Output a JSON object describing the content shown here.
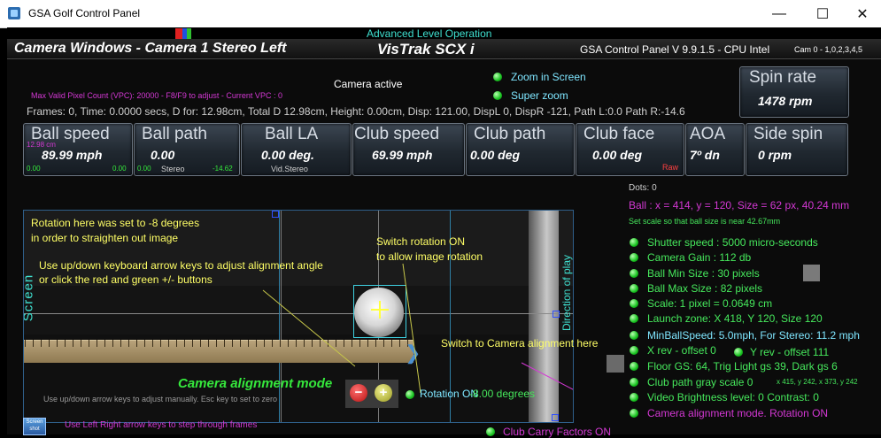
{
  "window": {
    "title": "GSA Golf Control Panel",
    "minimize": "—",
    "maximize": "☐",
    "close": "✕"
  },
  "banner": "Advanced Level Operation",
  "header": {
    "camera_title": "Camera Windows - Camera 1 Stereo Left",
    "product": "VisTrak SCX i",
    "version": "GSA Control Panel  V 9.9.1.5 - CPU Intel",
    "cams": "Cam 0 - 1,0,2,3,4,5"
  },
  "info": {
    "camera_active": "Camera active",
    "vpc": "Max Valid Pixel Count (VPC): 20000  - F8/F9 to adjust - Current VPC : 0",
    "frames": "Frames: 0, Time: 0.0000 secs, D for: 12.98cm, Total D 12.98cm, Height: 0.00cm, Disp: 121.00, DispL 0, DispR -121, Path L:0.0 Path R:-14.6",
    "zoom_in_screen": "Zoom in Screen",
    "super_zoom": "Super zoom"
  },
  "spin_rate": {
    "label": "Spin rate",
    "value": "1478 rpm"
  },
  "metrics": [
    {
      "label": "Ball speed",
      "value": "89.99 mph",
      "sub_top": "12.98 cm",
      "sub_left": "0.00",
      "sub_right": "0.00"
    },
    {
      "label": "Ball path",
      "value": "0.00",
      "sub_left": "0.00",
      "sub_mid": "Stereo",
      "sub_right": "-14.62"
    },
    {
      "label": "Ball LA",
      "value": "0.00 deg.",
      "sub_mid": "Vid.Stereo"
    },
    {
      "label": "Club speed",
      "value": "69.99 mph"
    },
    {
      "label": "Club path",
      "value": "0.00 deg"
    },
    {
      "label": "Club face",
      "value": "0.00 deg",
      "sub_right": "Raw"
    },
    {
      "label": "AOA",
      "value": "7º dn"
    },
    {
      "label": "Side spin",
      "value": "0 rpm"
    }
  ],
  "right_panel": {
    "dots": "Dots: 0",
    "ball": "Ball : x = 414, y = 120, Size = 62 px, 40.24 mm",
    "scale_hint": "Set scale so that ball size is near 42.67mm",
    "items": [
      "Shutter speed : 5000 micro-seconds",
      "Camera Gain : 112 db",
      "Ball Min Size : 30 pixels",
      "Ball Max Size : 82 pixels",
      "Scale: 1 pixel = 0.0649 cm",
      "Launch zone: X 418, Y 120, Size 120",
      "MinBallSpeed: 5.0mph, For Stereo: 11.2 mph"
    ],
    "x_rev": "X rev - offset 0",
    "y_rev": "Y rev - offset 111",
    "floor": "Floor GS: 64, Trig Light gs 39, Dark gs 6",
    "club_path_gray": "Club path gray scale 0",
    "coords": "x 415, y 242,  x 373, y 242",
    "video_brightness": "Video Brightness level: 0  Contrast: 0",
    "camera_alignment": "Camera alignment mode. Rotation ON"
  },
  "annotations": {
    "rotation_note_1": "Rotation here was set to -8 degrees",
    "rotation_note_2": "in order to straighten out image",
    "switch_rotation_1": "Switch rotation ON",
    "switch_rotation_2": "to allow image rotation",
    "keys_note_1": "Use up/down keyboard arrow keys to adjust alignment angle",
    "keys_note_2": "or click the red and green +/- buttons",
    "switch_camera": "Switch to Camera alignment here"
  },
  "camera_view": {
    "screen_label": "Screen",
    "direction_label": "Direction of play",
    "alignment_mode": "Camera alignment mode",
    "rotation_on": "Rotation ON",
    "degrees": "-8.00 degrees",
    "manual_hint": "Use up/down arrow keys to adjust manually. Esc key to set to zero",
    "minus": "−",
    "plus": "+"
  },
  "bottom": {
    "screenshot": "Screen shot",
    "frames_hint": "Use Left Right arrow keys to step through frames",
    "club_carry": "Club Carry Factors ON"
  },
  "colors": {
    "accent_green": "#35e83c",
    "magenta": "#d438d4",
    "yellow": "#ffff66",
    "cyan": "#3fe0d0"
  }
}
